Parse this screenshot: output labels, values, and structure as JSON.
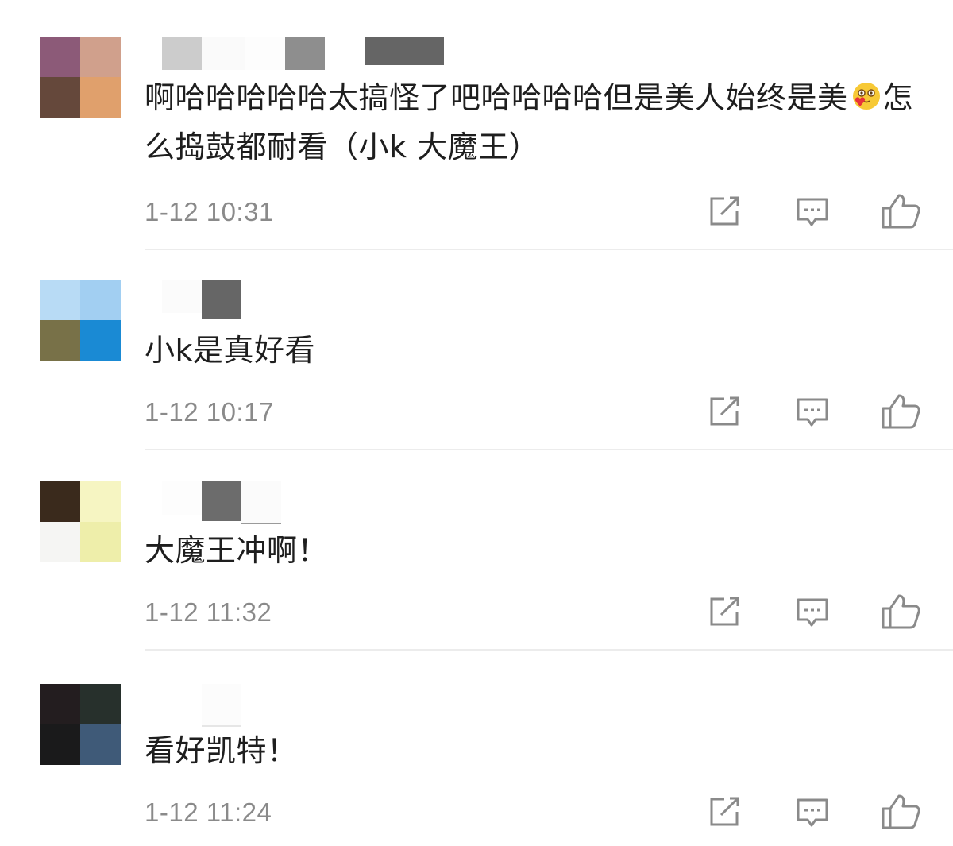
{
  "comments": [
    {
      "text_before_emoji": "啊哈哈哈哈哈太搞怪了吧哈哈哈哈但是美人始终是美",
      "text_after_emoji": "怎么捣鼓都耐看（小k 大魔王）",
      "emoji": "smiling-face-with-heart-emoji",
      "time": "1-12 10:31",
      "avatar_colors": [
        "#8c5a78",
        "#d0a08c",
        "#65483b",
        "#e0a06c"
      ]
    },
    {
      "text": "小k是真好看",
      "time": "1-12 10:17",
      "avatar_colors": [
        "#b8dbf5",
        "#a2cff2",
        "#787148",
        "#1a8ad4"
      ]
    },
    {
      "text": "大魔王冲啊！",
      "time": "1-12 11:32",
      "avatar_colors": [
        "#3a2a1c",
        "#f6f5c2",
        "#f5f5f3",
        "#eeeeaa"
      ]
    },
    {
      "text": "看好凯特！",
      "time": "1-12 11:24",
      "avatar_colors": [
        "#231d1f",
        "#27302c",
        "#1a1a1b",
        "#3f5a78"
      ]
    }
  ],
  "actions": {
    "share_icon": "share-icon",
    "comment_icon": "comment-icon",
    "like_icon": "thumbs-up-icon"
  },
  "colors": {
    "text": "#1e1e1e",
    "time": "#8a8a8a",
    "icon": "#8a8a8a",
    "divider": "#ececec"
  }
}
